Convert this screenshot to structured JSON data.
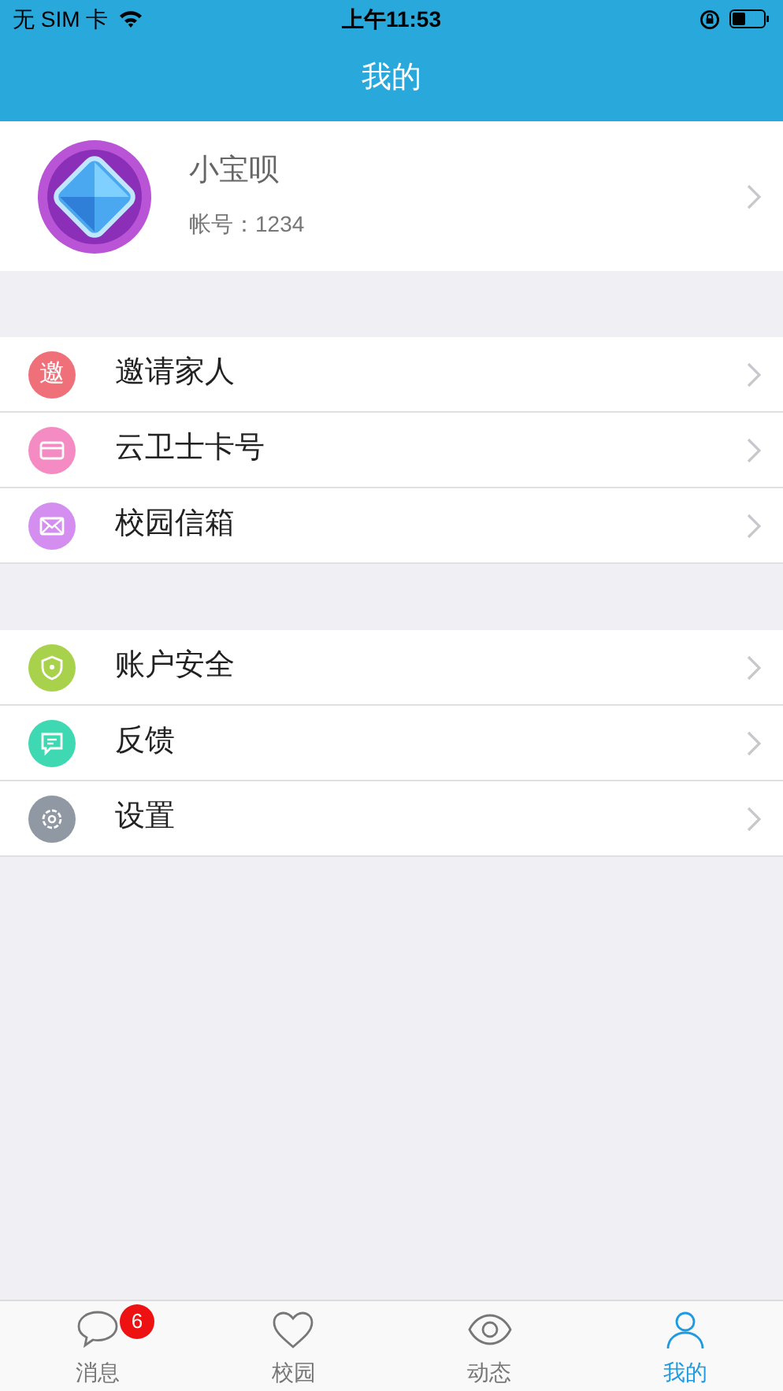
{
  "status_bar": {
    "carrier": "无 SIM 卡",
    "time": "上午11:53"
  },
  "nav_bar": {
    "title": "我的"
  },
  "profile": {
    "name": "小宝呗",
    "account": "帐号：1234"
  },
  "sections": [
    {
      "items": [
        {
          "label": "邀请家人",
          "kind": "glyph",
          "glyph": "邀",
          "color": "#f07079"
        },
        {
          "label": "云卫士卡号",
          "kind": "card",
          "color": "#f58bc3"
        },
        {
          "label": "校园信箱",
          "kind": "mail",
          "color": "#d48ef0"
        }
      ]
    },
    {
      "items": [
        {
          "label": "账户安全",
          "kind": "shield",
          "color": "#a9d24c"
        },
        {
          "label": "反馈",
          "kind": "chat",
          "color": "#3ed8b2"
        },
        {
          "label": "设置",
          "kind": "gear",
          "color": "#8f98a3"
        }
      ]
    }
  ],
  "tab_bar": [
    {
      "label": "消息",
      "kind": "chat",
      "badge": "6",
      "selected": false
    },
    {
      "label": "校园",
      "kind": "heart",
      "selected": false
    },
    {
      "label": "动态",
      "kind": "eye",
      "selected": false
    },
    {
      "label": "我的",
      "kind": "person",
      "selected": true
    }
  ]
}
